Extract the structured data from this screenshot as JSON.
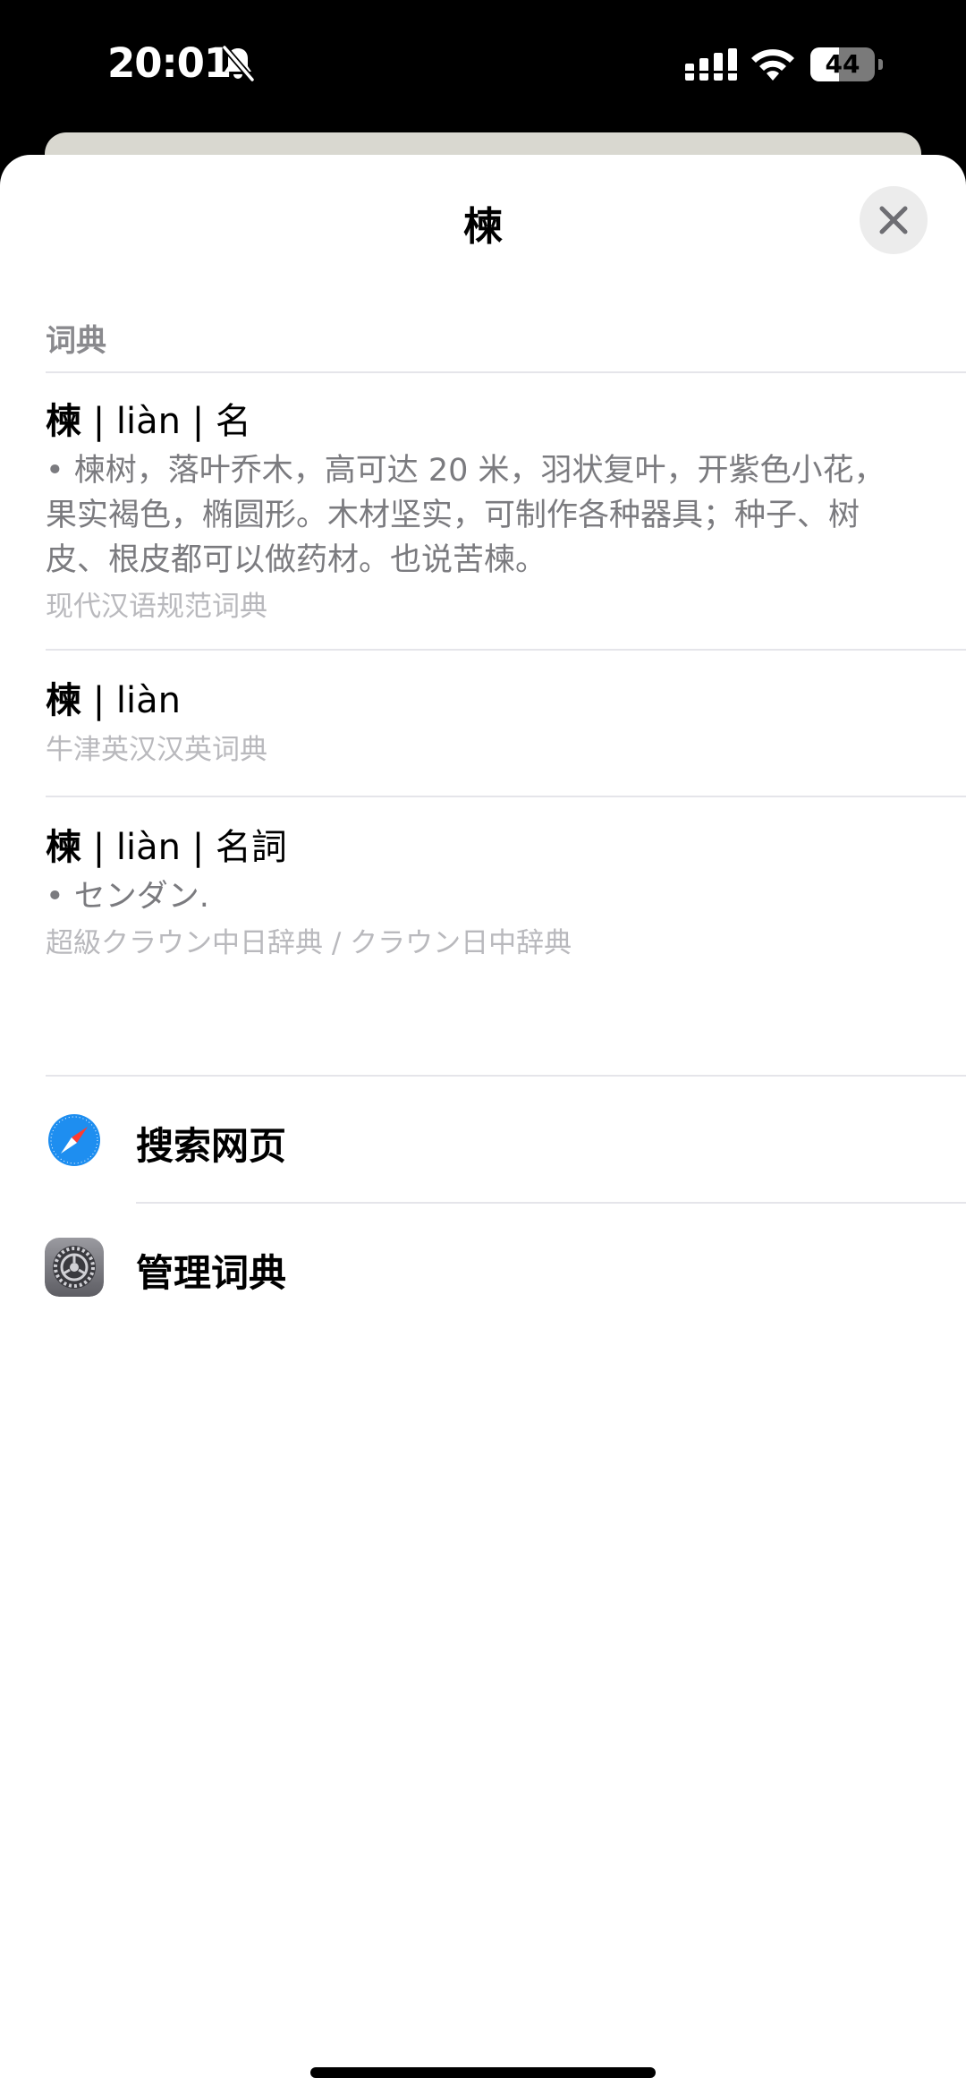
{
  "status_bar": {
    "time": "20:01",
    "battery_level": "44",
    "battery_fraction": 0.44,
    "icons": [
      "bell-slash-icon",
      "cellular-signal-icon",
      "wifi-icon",
      "battery-icon"
    ]
  },
  "sheet": {
    "title": "楝",
    "close_icon": "close-icon"
  },
  "dictionary": {
    "section_title": "词典",
    "entries": [
      {
        "headword": "楝",
        "sep1": " | ",
        "pinyin": "liàn",
        "sep2": " | ",
        "pos": "名",
        "definition": "• 楝树，落叶乔木，高可达 20 米，羽状复叶，开紫色小花，果实褐色，椭圆形。木材坚实，可制作各种器具；种子、树皮、根皮都可以做药材。也说苦楝。",
        "source": "现代汉语规范词典"
      },
      {
        "headword": "楝",
        "sep1": " | ",
        "pinyin": "liàn",
        "source": "牛津英汉汉英词典"
      },
      {
        "headword": "楝",
        "sep1": " | ",
        "pinyin": "liàn",
        "sep2": " | ",
        "pos": "名詞",
        "definition": "• センダン.",
        "source": "超級クラウン中日辞典 / クラウン日中辞典"
      }
    ]
  },
  "actions": [
    {
      "label": "搜索网页",
      "icon": "safari-compass-icon"
    },
    {
      "label": "管理词典",
      "icon": "settings-gear-icon"
    }
  ],
  "colors": {
    "secondary_text": "#7b7b7f",
    "source_text": "#b9b9bd",
    "section_header": "#8a8a8e",
    "safari_blue": "#1e8ef0"
  }
}
